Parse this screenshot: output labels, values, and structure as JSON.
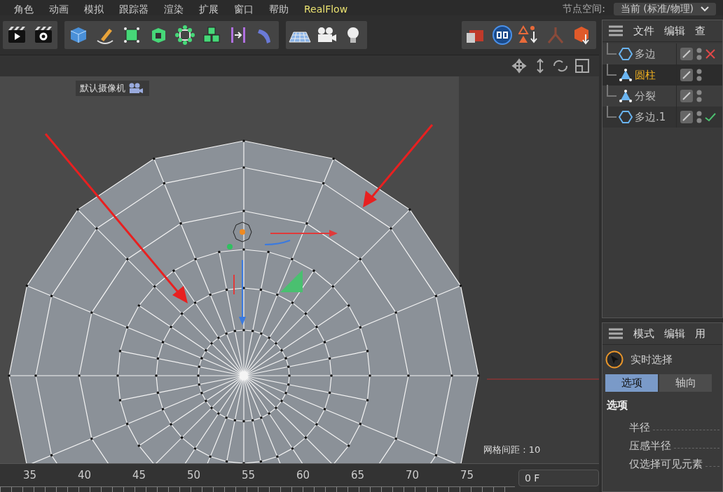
{
  "menu": [
    {
      "label": "角色"
    },
    {
      "label": "动画"
    },
    {
      "label": "模拟"
    },
    {
      "label": "跟踪器"
    },
    {
      "label": "渲染"
    },
    {
      "label": "扩展"
    },
    {
      "label": "窗口"
    },
    {
      "label": "帮助"
    },
    {
      "label": "RealFlow",
      "kind": "plugin"
    }
  ],
  "node_space": {
    "label": "节点空间:",
    "value": "当前 (标准/物理)"
  },
  "viewport": {
    "camera_label": "默认摄像机",
    "grid_spacing": "网格间距 : 10"
  },
  "object_manager": {
    "menu": [
      "文件",
      "编辑",
      "查"
    ],
    "objects": [
      {
        "name": "多边",
        "kind": "polygon",
        "selected": false,
        "off": true,
        "on": false
      },
      {
        "name": "圆柱",
        "kind": "generator",
        "selected": true,
        "off": false,
        "on": false
      },
      {
        "name": "分裂",
        "kind": "generator",
        "selected": false,
        "off": false,
        "on": false
      },
      {
        "name": "多边.1",
        "kind": "polygon",
        "selected": false,
        "off": false,
        "on": true
      }
    ]
  },
  "attribute_manager": {
    "menu": [
      "模式",
      "编辑",
      "用"
    ],
    "tool": "实时选择",
    "tabs": [
      {
        "label": "选项",
        "selected": true
      },
      {
        "label": "轴向",
        "selected": false
      }
    ],
    "section": "选项",
    "fields": [
      "半径",
      "压感半径",
      "仅选择可见元素"
    ]
  },
  "timeline": {
    "ticks": [
      "35",
      "40",
      "45",
      "50",
      "55",
      "60",
      "65",
      "70",
      "75"
    ],
    "frame": "0 F"
  }
}
